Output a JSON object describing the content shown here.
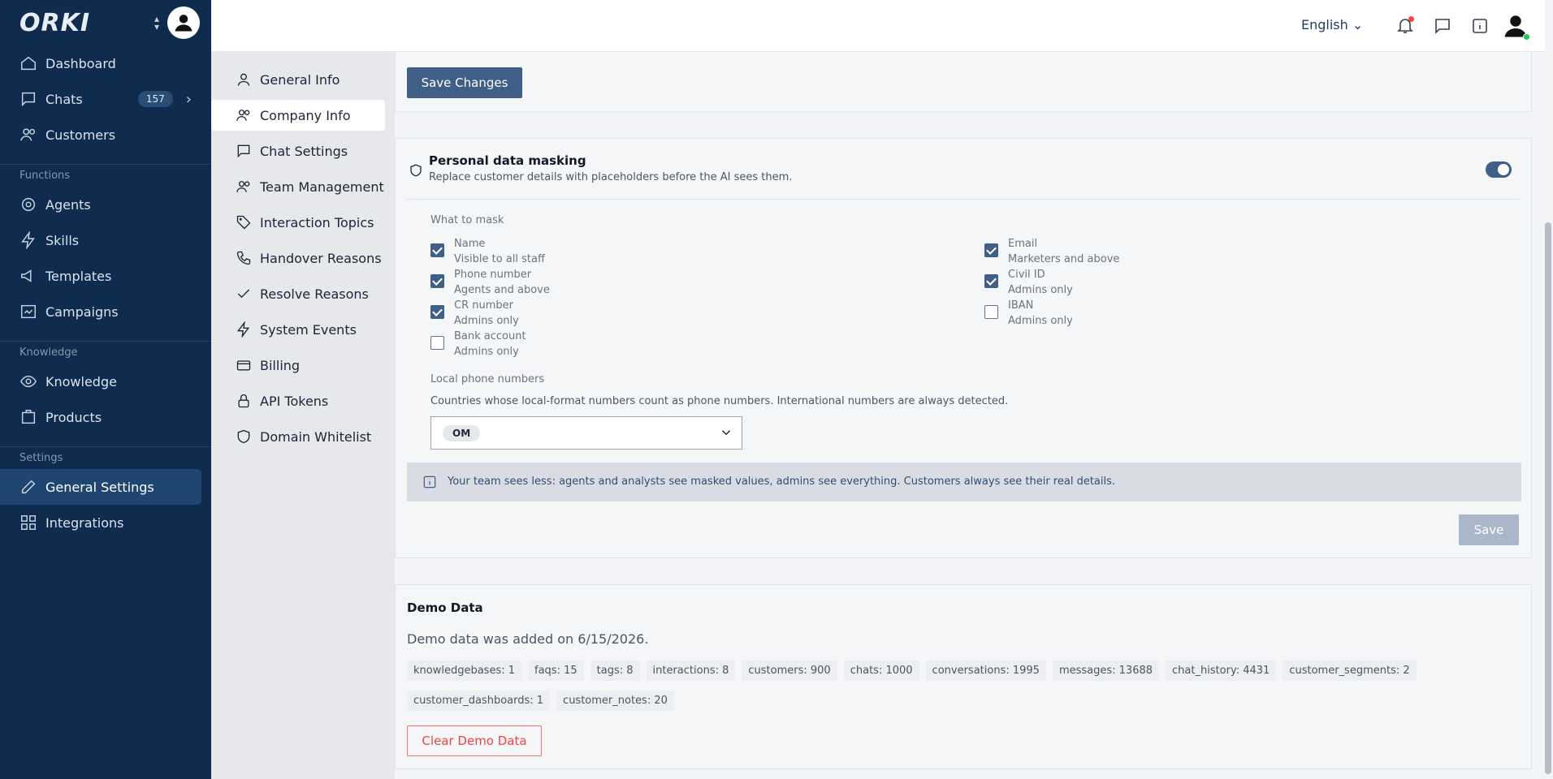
{
  "app": {
    "logo": "ORKI"
  },
  "sidebar": {
    "top_items": [
      {
        "label": "Dashboard",
        "icon": "home-icon"
      },
      {
        "label": "Chats",
        "icon": "chat-icon",
        "badge": "157"
      },
      {
        "label": "Customers",
        "icon": "users-icon"
      }
    ],
    "sections": [
      {
        "label": "Functions",
        "items": [
          {
            "label": "Agents",
            "icon": "agent-icon"
          },
          {
            "label": "Skills",
            "icon": "bolt-icon"
          },
          {
            "label": "Templates",
            "icon": "megaphone-icon"
          },
          {
            "label": "Campaigns",
            "icon": "campaign-icon"
          }
        ]
      },
      {
        "label": "Knowledge",
        "items": [
          {
            "label": "Knowledge",
            "icon": "eye-icon"
          },
          {
            "label": "Products",
            "icon": "box-icon"
          }
        ]
      },
      {
        "label": "Settings",
        "items": [
          {
            "label": "General Settings",
            "icon": "edit-icon"
          },
          {
            "label": "Integrations",
            "icon": "grid-icon"
          }
        ]
      }
    ]
  },
  "topbar": {
    "language": "English"
  },
  "subnav": [
    {
      "label": "General Info"
    },
    {
      "label": "Company Info"
    },
    {
      "label": "Chat Settings"
    },
    {
      "label": "Team Management"
    },
    {
      "label": "Interaction Topics"
    },
    {
      "label": "Handover Reasons"
    },
    {
      "label": "Resolve Reasons"
    },
    {
      "label": "System Events"
    },
    {
      "label": "Billing"
    },
    {
      "label": "API Tokens"
    },
    {
      "label": "Domain Whitelist"
    }
  ],
  "save_changes": {
    "label": "Save Changes"
  },
  "masking": {
    "title": "Personal data masking",
    "subtitle": "Replace customer details with placeholders before the AI sees them.",
    "enabled": true,
    "what_to_mask": "What to mask",
    "options_left": [
      {
        "name": "Name",
        "scope": "Visible to all staff",
        "checked": true
      },
      {
        "name": "Phone number",
        "scope": "Agents and above",
        "checked": true
      },
      {
        "name": "CR number",
        "scope": "Admins only",
        "checked": true
      },
      {
        "name": "Bank account",
        "scope": "Admins only",
        "checked": false
      }
    ],
    "options_right": [
      {
        "name": "Email",
        "scope": "Marketers and above",
        "checked": true
      },
      {
        "name": "Civil ID",
        "scope": "Admins only",
        "checked": true
      },
      {
        "name": "IBAN",
        "scope": "Admins only",
        "checked": false
      }
    ],
    "local_phone_label": "Local phone numbers",
    "local_phone_desc": "Countries whose local-format numbers count as phone numbers. International numbers are always detected.",
    "selected_country": "OM",
    "info": "Your team sees less: agents and analysts see masked values, admins see everything. Customers always see their real details.",
    "save_label": "Save"
  },
  "demo": {
    "title": "Demo Data",
    "description": "Demo data was added on 6/15/2026.",
    "tags": [
      "knowledgebases: 1",
      "faqs: 15",
      "tags: 8",
      "interactions: 8",
      "customers: 900",
      "chats: 1000",
      "conversations: 1995",
      "messages: 13688",
      "chat_history: 4431",
      "customer_segments: 2",
      "customer_dashboards: 1",
      "customer_notes: 20"
    ],
    "clear_label": "Clear Demo Data"
  }
}
